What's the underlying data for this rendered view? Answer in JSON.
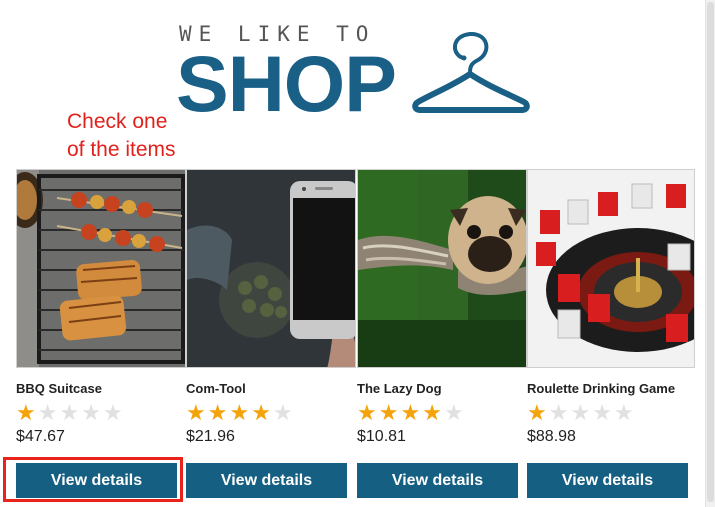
{
  "logo": {
    "tagline": "WE LIKE TO",
    "main": "SHOP"
  },
  "annotation": {
    "line1": "Check one",
    "line2": "of the items"
  },
  "products": [
    {
      "name": "BBQ Suitcase",
      "rating": 1,
      "price": "$47.67",
      "button": "View details",
      "image": "bbq-grill-image"
    },
    {
      "name": "Com-Tool",
      "rating": 4,
      "price": "$21.96",
      "button": "View details",
      "image": "smartphone-image"
    },
    {
      "name": "The Lazy Dog",
      "rating": 4,
      "price": "$10.81",
      "button": "View details",
      "image": "pug-dog-image"
    },
    {
      "name": "Roulette Drinking Game",
      "rating": 1,
      "price": "$88.98",
      "button": "View details",
      "image": "roulette-game-image"
    }
  ],
  "rating_max": 5,
  "colors": {
    "brand": "#1a5f86",
    "button": "#155f82",
    "star": "#f5a30b",
    "annotation": "#e0221c"
  }
}
